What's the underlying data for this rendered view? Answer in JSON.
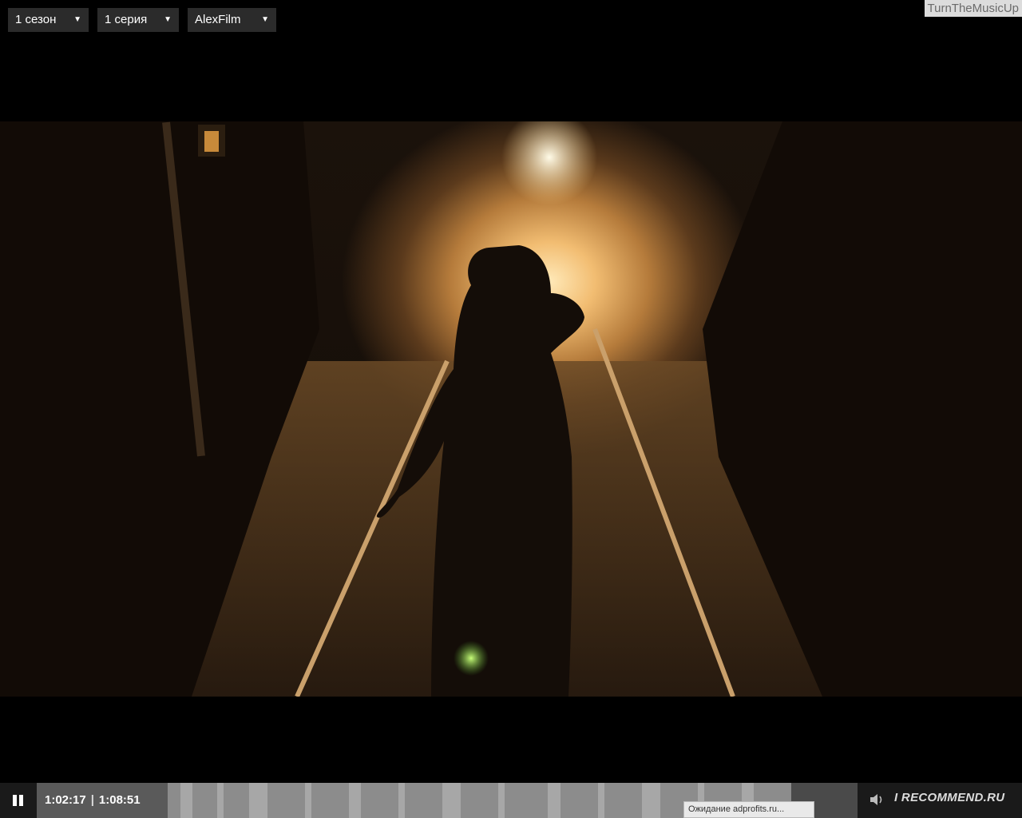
{
  "top_bar": {
    "season_select": "1 сезон",
    "episode_select": "1 серия",
    "voiceover_select": "AlexFilm",
    "caret": "▼"
  },
  "watermark": "TurnTheMusicUp",
  "player": {
    "current_time": "1:02:17",
    "separator": "|",
    "duration": "1:08:51",
    "progress_fraction": 0.904,
    "controls": {
      "pause_icon": "pause-icon",
      "volume_icon": "volume-icon"
    }
  },
  "status_bar_text": "Ожидание adprofits.ru...",
  "overlay_logo": "I RECOMMEND.RU",
  "colors": {
    "bar_bg": "#1a1a1a",
    "dropdown_bg": "#2b2b2b",
    "progress_played": "#8c8c8c",
    "progress_unplayed": "#4a4a4a"
  }
}
